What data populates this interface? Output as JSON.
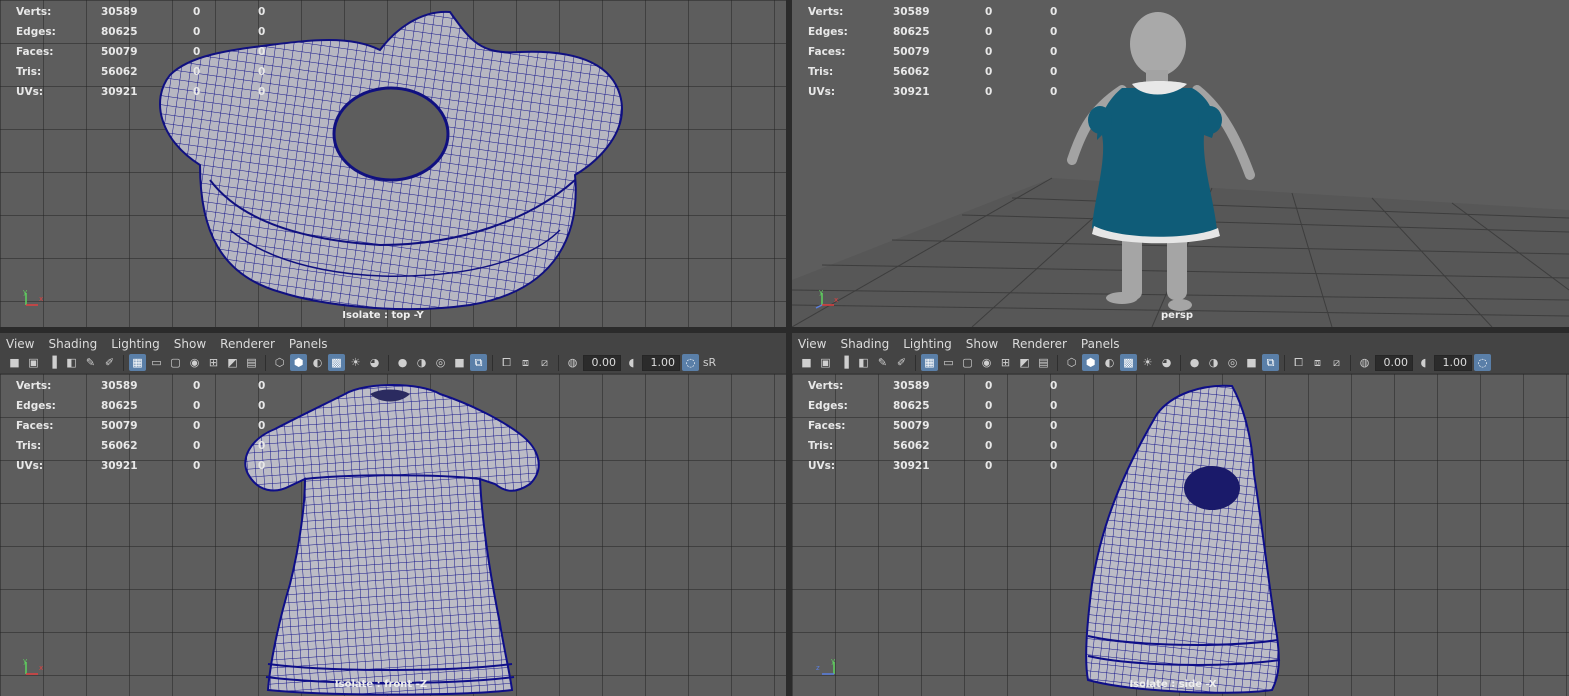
{
  "hud": {
    "rows": [
      {
        "label": "Verts:",
        "value": "30589",
        "sel": "0",
        "uv": "0"
      },
      {
        "label": "Edges:",
        "value": "80625",
        "sel": "0",
        "uv": "0"
      },
      {
        "label": "Faces:",
        "value": "50079",
        "sel": "0",
        "uv": "0"
      },
      {
        "label": "Tris:",
        "value": "56062",
        "sel": "0",
        "uv": "0"
      },
      {
        "label": "UVs:",
        "value": "30921",
        "sel": "0",
        "uv": "0"
      }
    ]
  },
  "viewports": {
    "top_left": {
      "camera": "Isolate : top -Y"
    },
    "top_right": {
      "camera": "persp"
    },
    "bottom_left": {
      "camera": "Isolate : front -Z"
    },
    "bottom_right": {
      "camera": "Isolate : side -X"
    }
  },
  "panel_menu": [
    "View",
    "Shading",
    "Lighting",
    "Show",
    "Renderer",
    "Panels"
  ],
  "toolbar": {
    "exposure": "0.00",
    "gamma": "1.00",
    "color_space": "sR"
  },
  "colors": {
    "wire": "#0d0d8a",
    "mesh": "#b9b9c4",
    "dress": "#0f5c78",
    "viewport_bg": "#5d5d5d"
  },
  "icons": [
    "camera-icon",
    "film-gate-icon",
    "grid-icon",
    "wireframe-icon",
    "smooth-shade-icon",
    "textured-icon",
    "light-icon",
    "isolate-select-icon",
    "xray-icon",
    "exposure-icon",
    "gamma-icon",
    "color-management-icon"
  ]
}
